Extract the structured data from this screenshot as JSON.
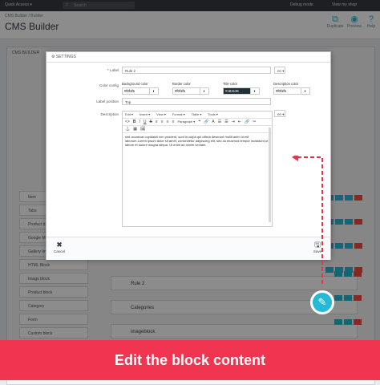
{
  "topbar": {
    "quick_access": "Quick Access ▾",
    "search_placeholder": "Search",
    "debug_mode": "Debug mode",
    "view_my_shop": "View my shop"
  },
  "header": {
    "breadcrumb": "CMS Builder  /  Builder",
    "title": "CMS Builder",
    "actions": [
      {
        "label": "Duplicate",
        "icon": "duplicate-icon"
      },
      {
        "label": "Preview",
        "icon": "eye-icon"
      },
      {
        "label": "Help",
        "icon": "help-icon"
      }
    ]
  },
  "background": {
    "panel_title": "CMS BUILDER",
    "sidebar_items": [
      "Item",
      "Tabs",
      "Product d...",
      "Google Ma...",
      "Gallery Im...",
      "HTML Block",
      "Image block",
      "Product block",
      "Category",
      "Form",
      "Custom block"
    ],
    "rows": [
      "Rule 2",
      "Categories",
      "imageblock"
    ]
  },
  "modal": {
    "header": "SETTINGS",
    "label_label": "Label",
    "label_value": "Rule 2",
    "lang_code": "en ▾",
    "color_config_label": "Color config",
    "colors": [
      {
        "title": "Background color",
        "value": "#f0f1f5",
        "color": "#f0f1f5"
      },
      {
        "title": "Border color",
        "value": "#f0f1f5",
        "color": "#f0f1f5"
      },
      {
        "title": "Title color",
        "value": "#1B3136",
        "color": "#1b3136"
      },
      {
        "title": "Description color",
        "value": "#f0f1f5",
        "color": "#f0f1f5"
      }
    ],
    "label_position_label": "Label position",
    "label_position_value": "Top",
    "description_label": "Description",
    "editor": {
      "menu": [
        "Edit ▾",
        "Insert ▾",
        "View ▾",
        "Format ▾",
        "Table ▾",
        "Tools ▾"
      ],
      "toolbar": [
        "<>",
        "B",
        "I",
        "U",
        "S",
        "≡",
        "≡",
        "≡",
        "≡",
        "Paragraph ▾",
        "❝",
        "🔗",
        "A",
        "☰",
        "☰",
        "⇥",
        "⇤",
        "🔗",
        "✂"
      ],
      "toolbar2": [
        "⚓",
        "▦",
        "🖼"
      ],
      "text": "sint occaecat cupidatat non proident, sunt in culpa qui officia deserunt mollit anim id est laborum.Lorem ipsum dolor sit amet, consectetur adipiscing elit, sed do eiusmod tempor incididunt ut labore et dolore magna aliqua. Ut enim ad minim veniam."
    },
    "footer": {
      "cancel": "Cancel",
      "save": "Save"
    }
  },
  "banner": "Edit the block content",
  "colors": {
    "accent": "#25b9d7",
    "banner": "#f1344f",
    "arrow": "#e8334a"
  }
}
